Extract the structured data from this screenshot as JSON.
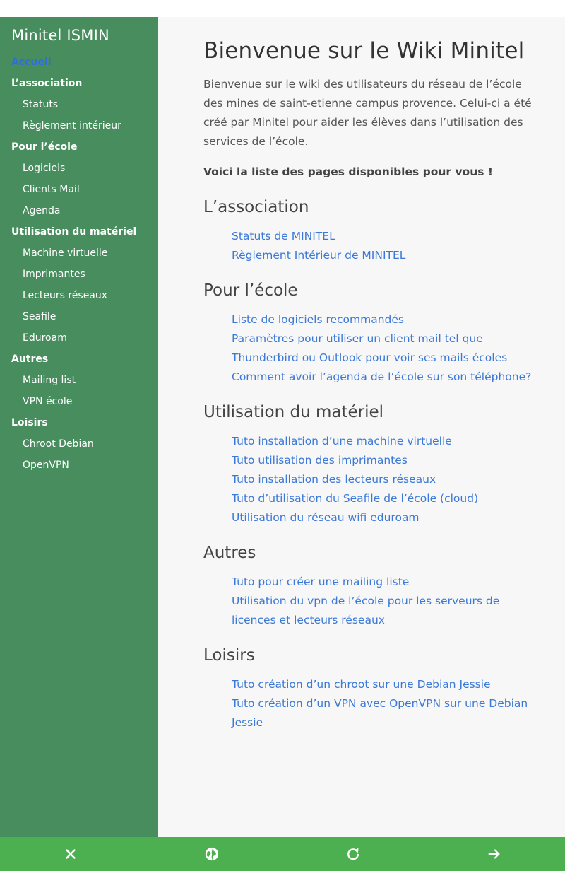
{
  "sidebar": {
    "site_title": "Minitel ISMIN",
    "items": [
      {
        "label": "Accueil",
        "level": "section",
        "active": true
      },
      {
        "label": "L’association",
        "level": "section"
      },
      {
        "label": "Statuts",
        "level": "sub"
      },
      {
        "label": "Règlement intérieur",
        "level": "sub"
      },
      {
        "label": "Pour l’école",
        "level": "section"
      },
      {
        "label": "Logiciels",
        "level": "sub"
      },
      {
        "label": "Clients Mail",
        "level": "sub"
      },
      {
        "label": "Agenda",
        "level": "sub"
      },
      {
        "label": "Utilisation du matériel",
        "level": "section"
      },
      {
        "label": "Machine virtuelle",
        "level": "sub"
      },
      {
        "label": "Imprimantes",
        "level": "sub"
      },
      {
        "label": "Lecteurs réseaux",
        "level": "sub"
      },
      {
        "label": "Seafile",
        "level": "sub"
      },
      {
        "label": "Eduroam",
        "level": "sub"
      },
      {
        "label": "Autres",
        "level": "section"
      },
      {
        "label": "Mailing list",
        "level": "sub"
      },
      {
        "label": "VPN école",
        "level": "sub"
      },
      {
        "label": "Loisirs",
        "level": "section"
      },
      {
        "label": "Chroot Debian",
        "level": "sub"
      },
      {
        "label": "OpenVPN",
        "level": "sub"
      }
    ]
  },
  "main": {
    "title": "Bienvenue sur le Wiki Minitel",
    "intro": "Bienvenue sur le wiki des utilisateurs du réseau de l’école des mines de saint-etienne campus provence. Celui-ci a été créé par Minitel pour aider les élèves dans l’utilisation des services de l’école.",
    "lead": "Voici la liste des pages disponibles pour vous !",
    "sections": [
      {
        "heading": "L’association",
        "links": [
          "Statuts de MINITEL",
          "Règlement Intérieur de MINITEL"
        ]
      },
      {
        "heading": "Pour l’école",
        "links": [
          "Liste de logiciels recommandés",
          "Paramètres pour utiliser un client mail tel que Thunderbird ou Outlook pour voir ses mails écoles",
          "Comment avoir l’agenda de l’école sur son téléphone?"
        ]
      },
      {
        "heading": "Utilisation du matériel",
        "links": [
          "Tuto installation d’une machine virtuelle",
          "Tuto utilisation des imprimantes",
          "Tuto installation des lecteurs réseaux",
          "Tuto d’utilisation du Seafile de l’école (cloud)",
          "Utilisation du réseau wifi eduroam"
        ]
      },
      {
        "heading": "Autres",
        "links": [
          "Tuto pour créer une mailing liste",
          "Utilisation du vpn de l’école pour les serveurs de licences et lecteurs réseaux"
        ]
      },
      {
        "heading": "Loisirs",
        "links": [
          "Tuto création d’un chroot sur une Debian Jessie",
          "Tuto création d’un VPN avec OpenVPN sur une Debian Jessie"
        ]
      }
    ]
  },
  "bottom_bar": {
    "buttons": [
      {
        "icon": "close-icon"
      },
      {
        "icon": "globe-icon"
      },
      {
        "icon": "refresh-icon"
      },
      {
        "icon": "arrow-forward-icon"
      }
    ]
  },
  "colors": {
    "sidebar_bg": "#488d5e",
    "bottom_bar_bg": "#4caf50",
    "link": "#3b79d8",
    "active_nav": "#2f6fd6"
  }
}
